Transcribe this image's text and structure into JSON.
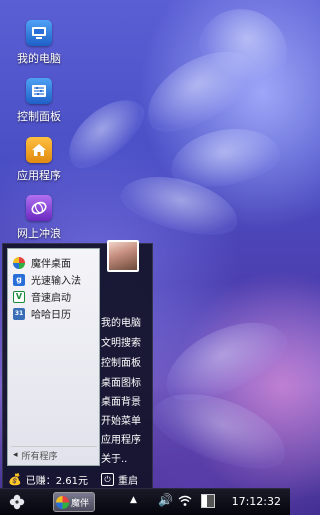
{
  "desktop": {
    "icons": [
      {
        "label": "我的电脑",
        "icon": "computer-icon"
      },
      {
        "label": "控制面板",
        "icon": "control-panel-icon"
      },
      {
        "label": "应用程序",
        "icon": "home-icon"
      },
      {
        "label": "网上冲浪",
        "icon": "browser-icon"
      }
    ]
  },
  "start_menu": {
    "apps": [
      {
        "label": "魔伴桌面",
        "icon": "pinwheel-icon"
      },
      {
        "label": "光速输入法",
        "icon": "g-input-icon"
      },
      {
        "label": "音速启动",
        "icon": "v-launcher-icon"
      },
      {
        "label": "哈哈日历",
        "icon": "calendar-icon"
      }
    ],
    "all_programs": "所有程序",
    "right_items": [
      "我的电脑",
      "文明搜索",
      "控制面板",
      "桌面图标",
      "桌面背景",
      "开始菜单",
      "应用程序",
      "关于.."
    ],
    "earned": "已赚：2.61元",
    "restart": "重启"
  },
  "taskbar": {
    "task_label": "魔伴",
    "clock": "17:12:32"
  },
  "colors": {
    "accent_blue": "#2a6fd8",
    "home_orange": "#f0a020",
    "browser_purple": "#8a3ed8"
  }
}
